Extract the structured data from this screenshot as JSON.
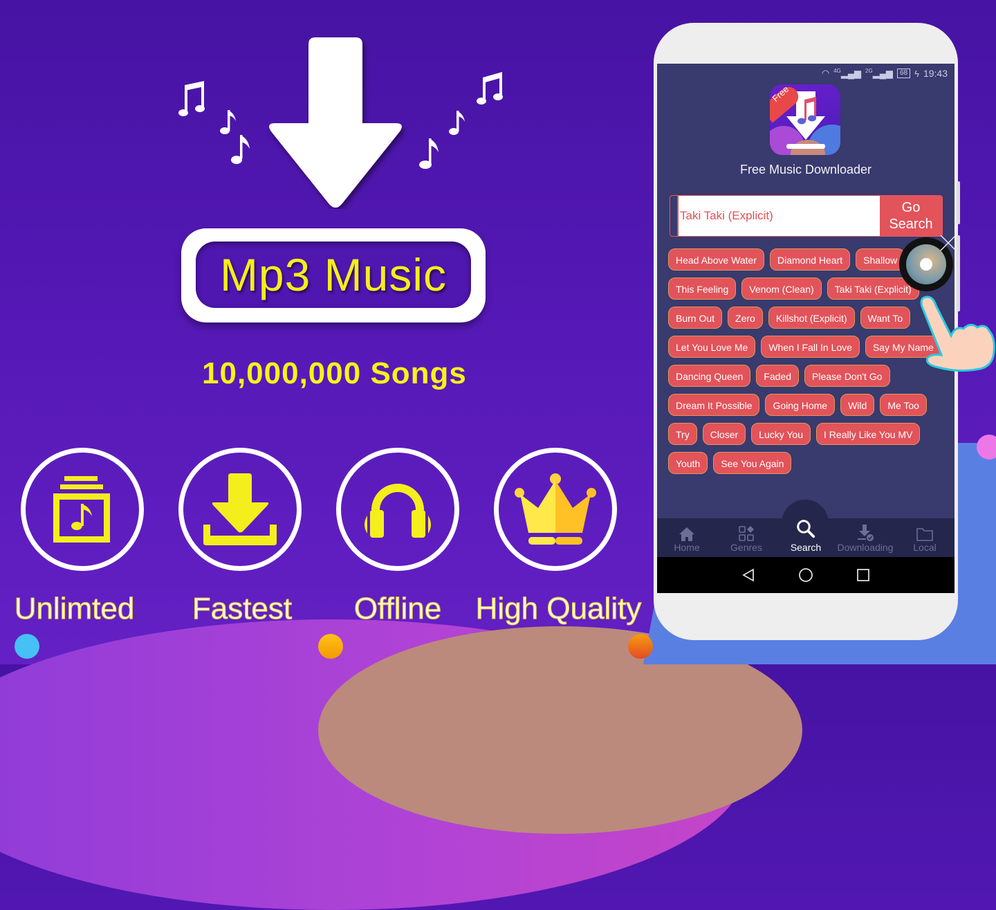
{
  "promo": {
    "headline": "Mp3 Music",
    "songs_count": "10,000,000 Songs",
    "features": [
      {
        "label": "Unlimted",
        "icon": "music-album-icon"
      },
      {
        "label": "Fastest",
        "icon": "download-icon"
      },
      {
        "label": "Offline",
        "icon": "headphones-icon"
      },
      {
        "label": "High Quality",
        "icon": "crown-icon"
      }
    ],
    "colors": {
      "background": "#4a15a8",
      "accent_yellow": "#f5ee1d",
      "chip_red": "#e2535a",
      "phone_screen": "#393a6d"
    }
  },
  "phone": {
    "status_bar": {
      "network1": "4G",
      "network2": "2G",
      "battery": "68",
      "time": "19:43"
    },
    "app": {
      "icon_badge": "Free",
      "title": "Free Music Downloader"
    },
    "search": {
      "value": "Taki Taki (Explicit)",
      "button_line1": "Go",
      "button_line2": "Search"
    },
    "suggestions": [
      "Head Above Water",
      "Diamond Heart",
      "Shallow",
      "This Feeling",
      "Venom (Clean)",
      "Taki Taki (Explicit)",
      "Burn Out",
      "Zero",
      "Killshot (Explicit)",
      "Want To",
      "Let You Love Me",
      "When I Fall In Love",
      "Say My Name",
      "Dancing Queen",
      "Faded",
      "Please Don't Go",
      "Dream It Possible",
      "Going Home",
      "Wild",
      "Me Too",
      "Try",
      "Closer",
      "Lucky You",
      "I Really Like You MV",
      "Youth",
      "See You Again"
    ],
    "bottom_nav": [
      {
        "label": "Home",
        "icon": "home-icon",
        "active": false
      },
      {
        "label": "Genres",
        "icon": "genres-icon",
        "active": false
      },
      {
        "label": "Search",
        "icon": "search-icon",
        "active": true
      },
      {
        "label": "Downloading",
        "icon": "downloading-icon",
        "active": false
      },
      {
        "label": "Local",
        "icon": "folder-icon",
        "active": false
      }
    ]
  }
}
